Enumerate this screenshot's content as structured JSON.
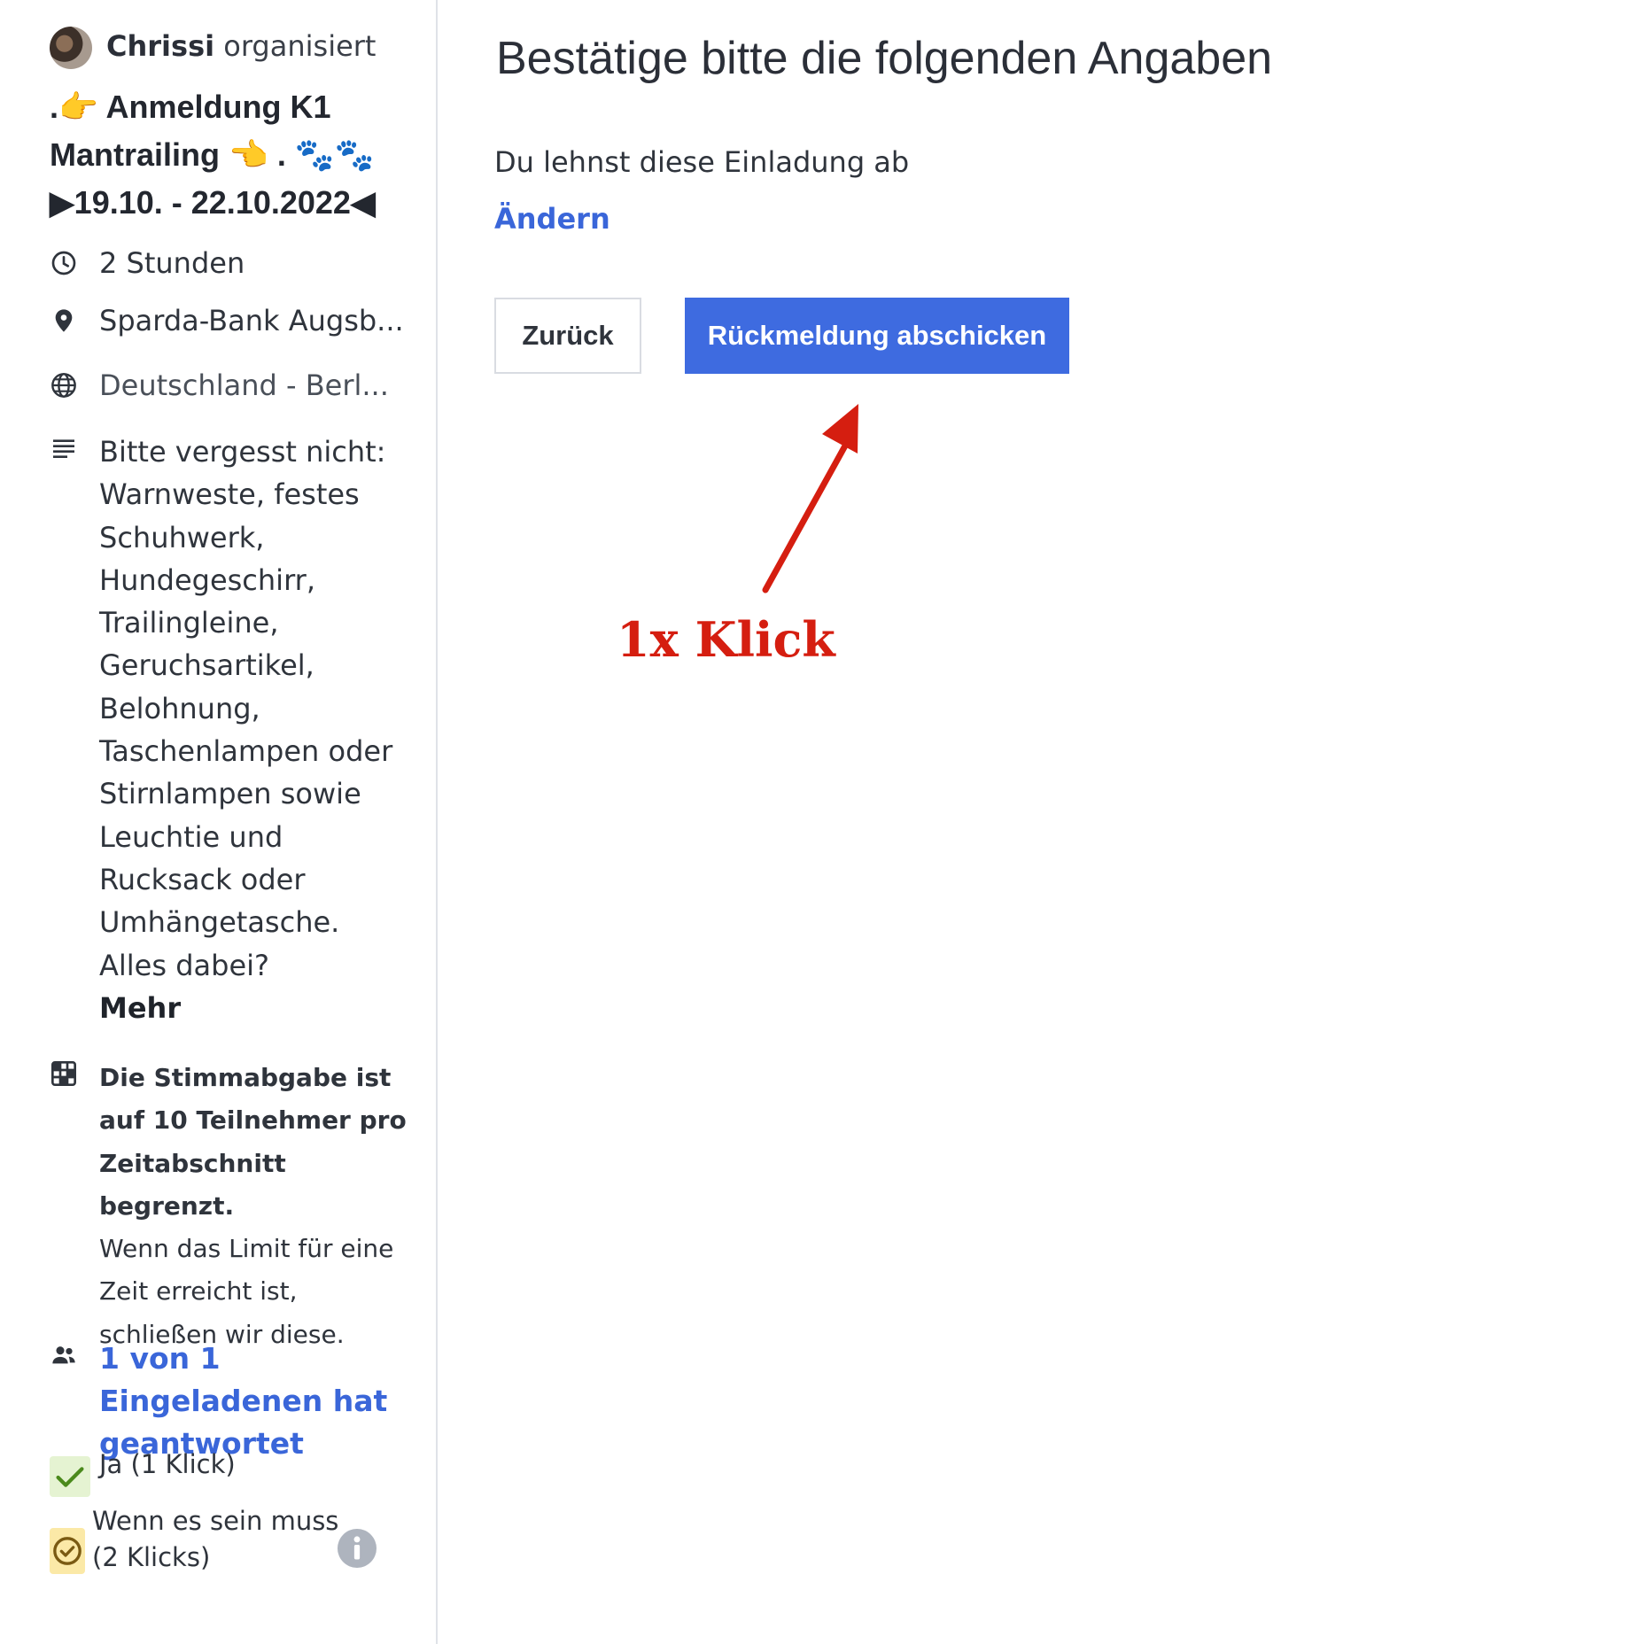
{
  "sidebar": {
    "organizer_name": "Chrissi",
    "organizer_suffix": "organisiert",
    "title_line1": ".👉 Anmeldung K1",
    "title_line2": "Mantrailing 👈 . 🐾🐾",
    "title_line3": "▶19.10. - 22.10.2022◀",
    "duration": "2 Stunden",
    "location": "Sparda-Bank Augsb...",
    "timezone": "Deutschland - Berl...",
    "description": "Bitte vergesst nicht: Warnweste, festes Schuhwerk, Hundegeschirr, Trailingleine, Geruchsartikel, Belohnung, Taschenlampen oder Stirnlampen sowie Leuchtie und Rucksack oder Umhängetasche. Alles dabei?",
    "more_label": "Mehr",
    "limit_title": "Die Stimmabgabe ist auf 10 Teilnehmer pro Zeitabschnitt begrenzt.",
    "limit_text": "Wenn das Limit für eine Zeit erreicht ist, schließen wir diese.",
    "invited_status": "1 von 1 Eingeladenen hat geantwortet",
    "legend_yes": "Ja (1 Klick)",
    "legend_maybe_line1": "Wenn es sein muss",
    "legend_maybe_line2": "(2 Klicks)"
  },
  "main": {
    "heading": "Bestätige bitte die folgenden Angaben",
    "decision_text": "Du lehnst diese Einladung ab",
    "change_link": "Ändern",
    "back_button": "Zurück",
    "submit_button": "Rückmeldung abschicken",
    "annotation": "1x Klick"
  },
  "colors": {
    "accent": "#3e6be0",
    "link": "#3a66d9",
    "annotation": "#d51e10",
    "yes_badge": "#e5f3d2",
    "maybe_badge": "#fbe9a7"
  },
  "icons": {
    "duration": "clock-icon",
    "location": "location-pin-icon",
    "timezone": "globe-icon",
    "description": "text-lines-icon",
    "limit": "grid-icon",
    "participants": "people-icon",
    "yes": "check-icon",
    "maybe": "check-circle-icon",
    "info": "info-icon",
    "arrow": "arrow-icon"
  }
}
